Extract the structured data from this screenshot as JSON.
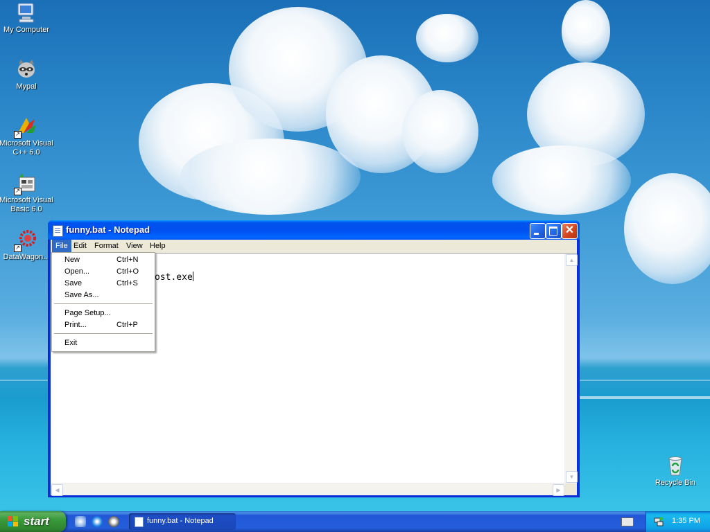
{
  "desktop": {
    "icons": [
      {
        "label": "My Computer"
      },
      {
        "label": "Mypal"
      },
      {
        "label": "Microsoft Visual C++ 6.0"
      },
      {
        "label": "Microsoft Visual Basic 6.0"
      },
      {
        "label": "DataWagon..."
      },
      {
        "label": "Recycle Bin"
      }
    ]
  },
  "window": {
    "title": "funny.bat - Notepad",
    "menus": [
      "File",
      "Edit",
      "Format",
      "View",
      "Help"
    ],
    "active_menu": "File",
    "visible_text": "ost.exe"
  },
  "file_menu": {
    "items": [
      {
        "label": "New",
        "shortcut": "Ctrl+N"
      },
      {
        "label": "Open...",
        "shortcut": "Ctrl+O"
      },
      {
        "label": "Save",
        "shortcut": "Ctrl+S"
      },
      {
        "label": "Save As...",
        "shortcut": ""
      },
      {
        "label": "Page Setup...",
        "shortcut": ""
      },
      {
        "label": "Print...",
        "shortcut": "Ctrl+P"
      },
      {
        "label": "Exit",
        "shortcut": ""
      }
    ]
  },
  "taskbar": {
    "start_label": "start",
    "task_button": "funny.bat - Notepad",
    "clock": "1:35 PM"
  },
  "colors": {
    "title_bar": "#0054e3",
    "menu_highlight": "#316ac5",
    "start_button": "#3a9a3a",
    "taskbar": "#245edb",
    "close_button": "#d1431b"
  }
}
